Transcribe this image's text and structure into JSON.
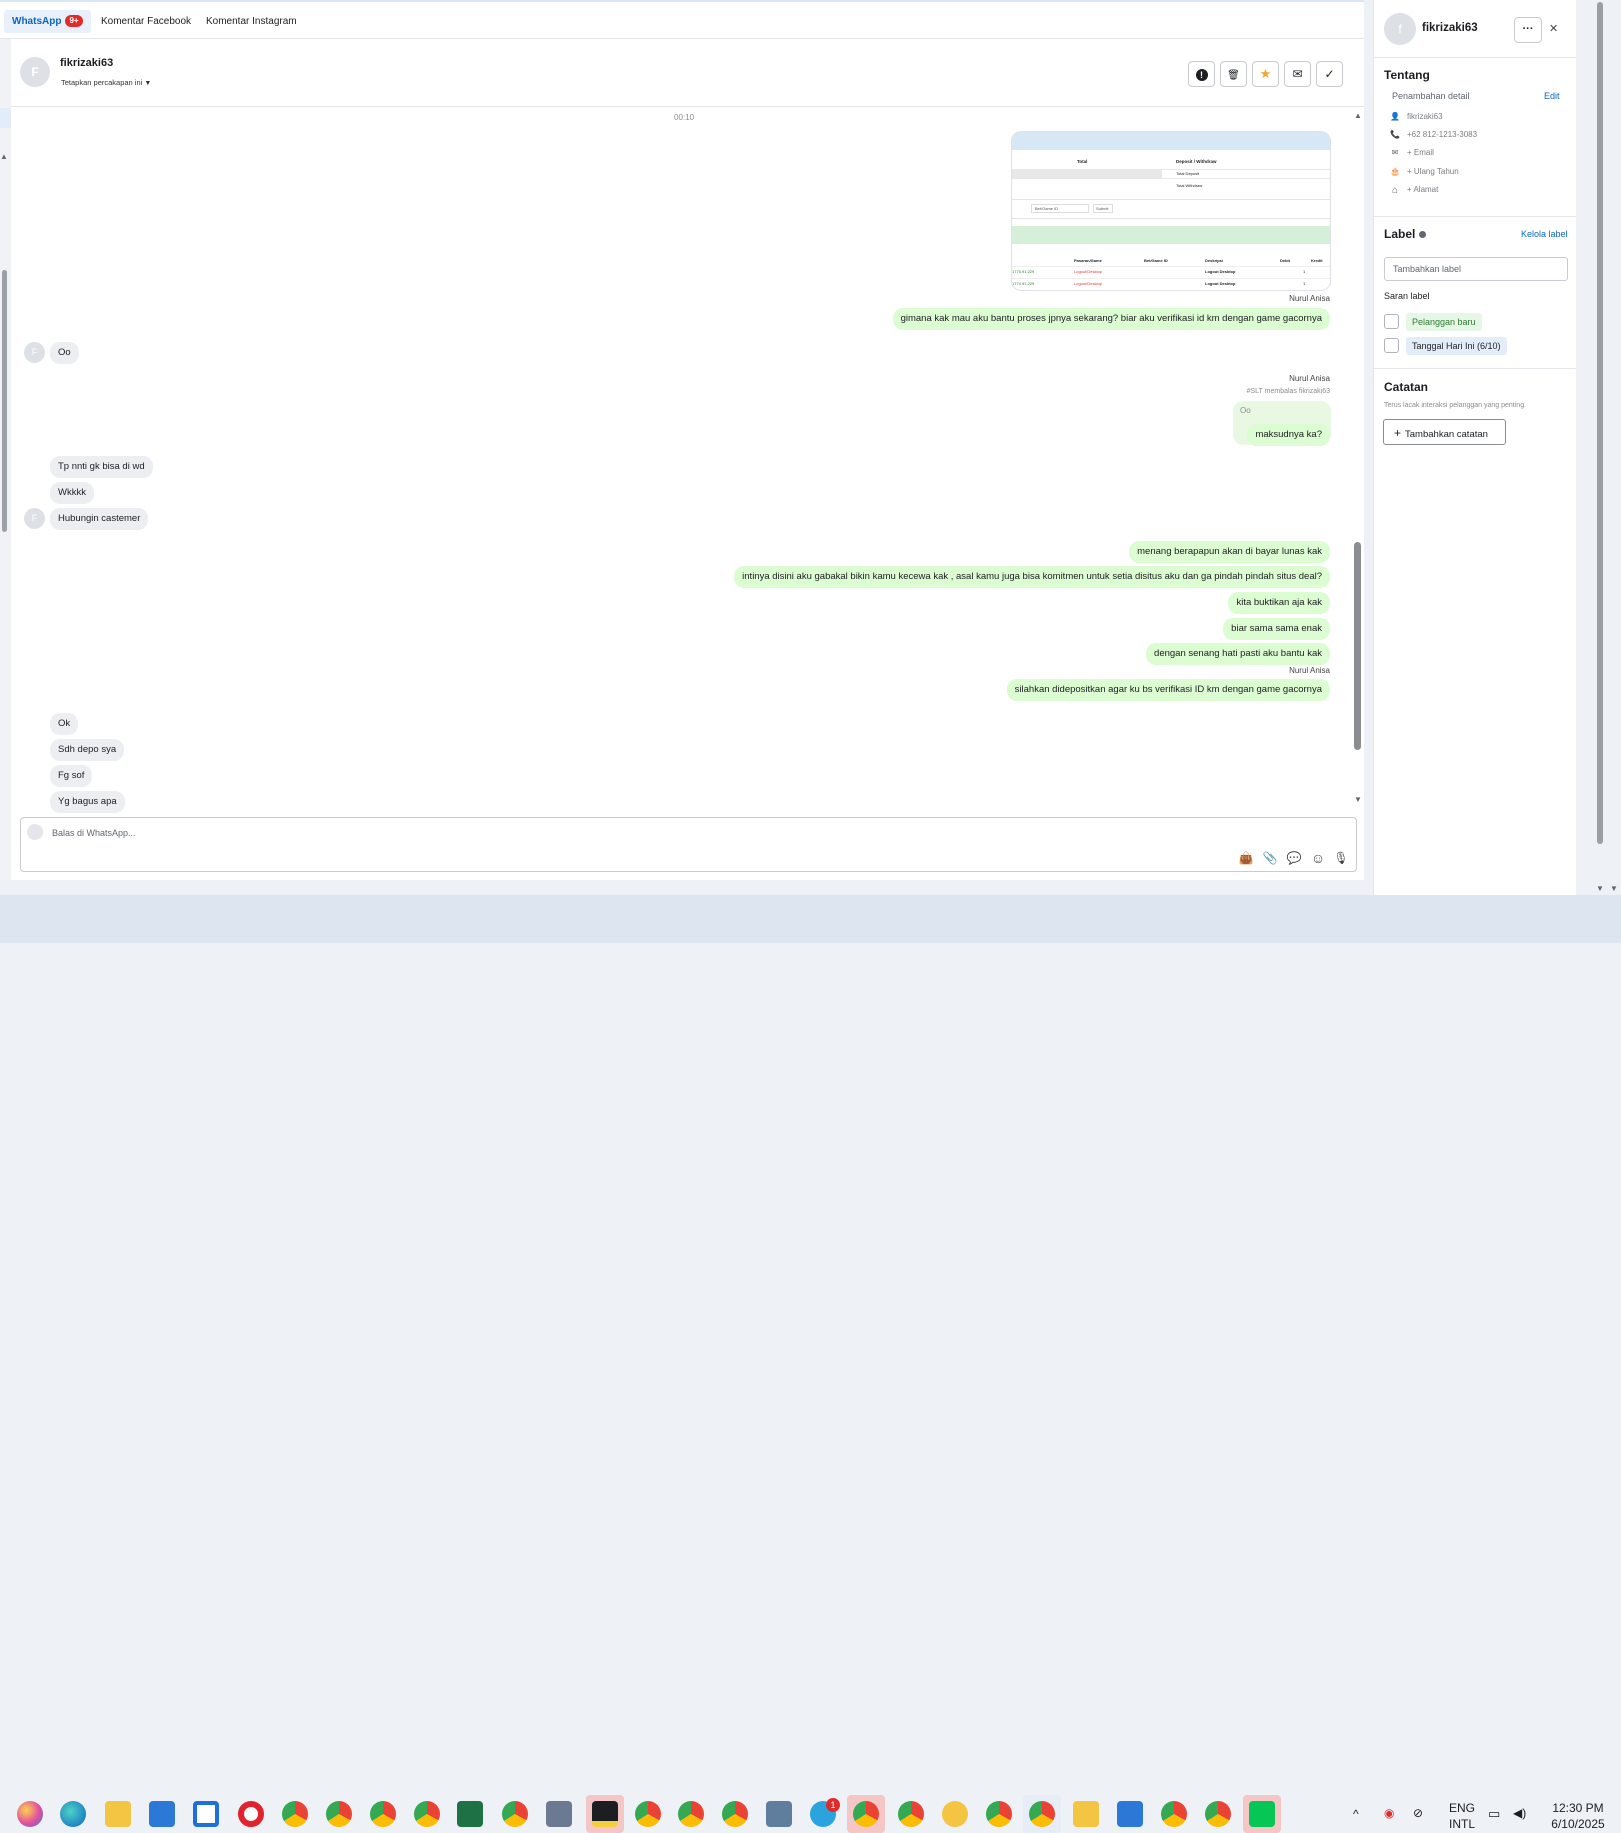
{
  "tabs": [
    {
      "label": "WhatsApp",
      "badge": "9+"
    },
    {
      "label": "Komentar Facebook"
    },
    {
      "label": "Komentar Instagram"
    }
  ],
  "chat_header": {
    "avatar_letter": "F",
    "name": "fikrizaki63",
    "assign": "Tetapkan percakapan ini",
    "assign_caret": "▼"
  },
  "header_buttons": [
    "alert-icon",
    "trash-icon",
    "star-icon",
    "mail-icon",
    "check-icon"
  ],
  "header_glyphs": {
    "alert": "!",
    "trash": "🗑",
    "star": "★",
    "mail": "✉",
    "check": "✓"
  },
  "timestamp": "00:10",
  "screenshot_card": {
    "col1": "Total",
    "col2": "Deposit / Withdraw",
    "row1": "Total Deposit",
    "row2": "Total Withdraw",
    "input_placeholder": "Bet/Game ID",
    "submit": "Submit",
    "table_headers": [
      "Pasaran/Game",
      "Bet/Game ID",
      "Deskripsi",
      "Debit",
      "Kredit"
    ],
    "table_rows": [
      [
        "1775.91.229",
        "Logout/Desktop",
        "Logout Desktop",
        "1"
      ],
      [
        "1774.91.229",
        "Logout/Desktop",
        "Logout Desktop",
        "1"
      ]
    ]
  },
  "messages": {
    "sender_agent": "Nurul Anisa",
    "reply_note": "#SLT membalas fikrizaki63",
    "quoted": "Oo",
    "m1": "gimana kak mau aku bantu proses jpnya sekarang? biar aku verifikasi id km dengan game gacornya",
    "m2": "Oo",
    "m3": "maksudnya ka?",
    "m4": "Tp nnti gk bisa di wd",
    "m5": "Wkkkk",
    "m6": "Hubungin castemer",
    "m7": "menang berapapun akan di bayar lunas kak",
    "m8": "intinya disini aku gabakal bikin kamu kecewa kak , asal kamu juga bisa komitmen untuk setia disitus aku dan ga pindah pindah situs deal?",
    "m9": "kita buktikan aja kak",
    "m10": "biar sama sama enak",
    "m11": "dengan senang hati pasti aku bantu kak",
    "m12": "silahkan didepositkan agar ku bs verifikasi ID km dengan game gacornya",
    "m13": "Ok",
    "m14": "Sdh depo sya",
    "m15": "Fg sof",
    "m16": "Yg bagus apa"
  },
  "composer": {
    "placeholder": "Balas di WhatsApp...",
    "icons": [
      "bag-icon",
      "attach-icon",
      "message-template-icon",
      "emoji-icon",
      "mic-icon"
    ],
    "glyphs": {
      "bag": "👜",
      "attach": "📎",
      "template": "💬",
      "emoji": "☺",
      "mic": "🎙"
    }
  },
  "right_panel": {
    "avatar_letter": "f",
    "name": "fikrizaki63",
    "more": "···",
    "close": "✕",
    "tentang": "Tentang",
    "penambahan": "Penambahan detail",
    "edit": "Edit",
    "details": [
      {
        "icon": "person-icon",
        "glyph": "👤",
        "text": "fikrizaki63"
      },
      {
        "icon": "phone-icon",
        "glyph": "📞",
        "text": "+62 812-1213-3083"
      },
      {
        "icon": "email-icon",
        "glyph": "✉",
        "text": "+ Email"
      },
      {
        "icon": "cake-icon",
        "glyph": "🎂",
        "text": "+ Ulang Tahun"
      },
      {
        "icon": "home-icon",
        "glyph": "⌂",
        "text": "+ Alamat"
      }
    ],
    "label_title": "Label",
    "kelola": "Kelola label",
    "label_placeholder": "Tambahkan label",
    "saran": "Saran label",
    "suggestions": [
      "Pelanggan baru",
      "Tanggal Hari Ini (6/10)"
    ],
    "catatan": "Catatan",
    "catatan_desc": "Terus lacak interaksi pelanggan yang penting.",
    "add_note": "Tambahkan catatan",
    "add_glyph": "+"
  },
  "taskbar": {
    "lang1": "ENG",
    "lang2": "INTL",
    "time": "12:30 PM",
    "date": "6/10/2025",
    "telegram_badge": "1"
  },
  "colors": {
    "accent": "#0a66c2",
    "outgoing": "#dcfcd2",
    "incoming": "#eceef1",
    "star": "#f5a623"
  }
}
